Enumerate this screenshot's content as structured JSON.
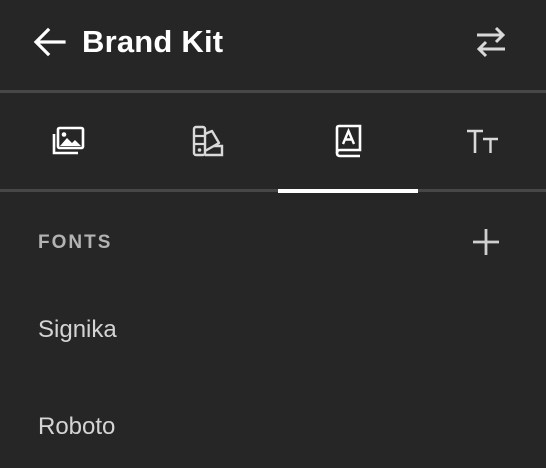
{
  "header": {
    "title": "Brand Kit",
    "back_icon": "arrow-left-icon",
    "swap_icon": "swap-arrows-icon"
  },
  "tabs": [
    {
      "icon": "images-icon",
      "selected": false
    },
    {
      "icon": "color-palette-icon",
      "selected": false
    },
    {
      "icon": "font-book-icon",
      "selected": true
    },
    {
      "icon": "text-size-icon",
      "selected": false
    }
  ],
  "fonts_section": {
    "label": "FONTS",
    "add_icon": "plus-icon",
    "items": [
      {
        "label": "Signika"
      },
      {
        "label": "Roboto"
      }
    ]
  },
  "colors": {
    "background": "#262626",
    "divider": "#474747",
    "text": "#ffffff",
    "muted_text": "#b3b3b3",
    "item_text": "#d4d4d4"
  }
}
